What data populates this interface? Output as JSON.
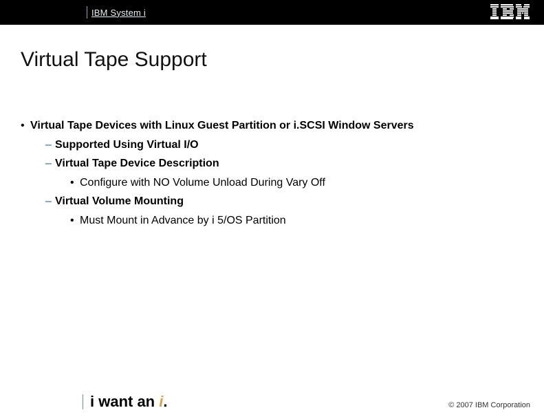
{
  "header": {
    "label": "IBM System i"
  },
  "title": "Virtual Tape Support",
  "bullets": {
    "b1": "Virtual Tape Devices with Linux Guest Partition or i.SCSI Window Servers",
    "b1a": "Supported Using Virtual I/O",
    "b1b": "Virtual Tape Device Description",
    "b1b1": "Configure with NO Volume Unload During Vary Off",
    "b1c": "Virtual Volume Mounting",
    "b1c1": "Must Mount in Advance by i 5/OS Partition"
  },
  "footer": {
    "tagline_prefix": "i want an ",
    "tagline_accent": "i",
    "tagline_suffix": ".",
    "copyright": "© 2007 IBM Corporation"
  }
}
